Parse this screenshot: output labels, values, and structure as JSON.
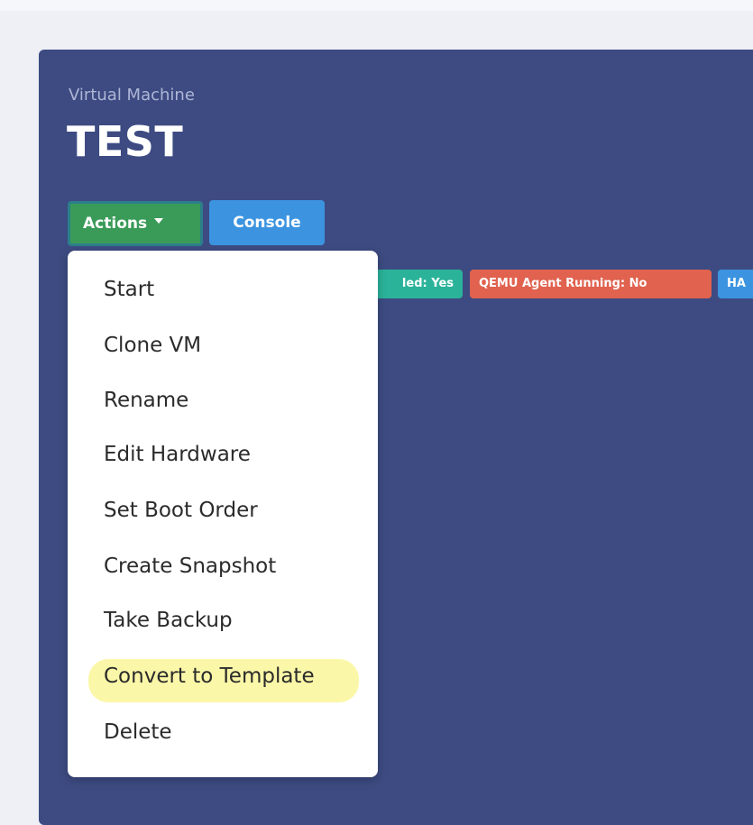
{
  "header": {
    "subtitle": "Virtual Machine",
    "title": "TEST"
  },
  "toolbar": {
    "actions_label": "Actions",
    "console_label": "Console"
  },
  "badges": [
    {
      "text": "led: Yes",
      "color": "#2bb39a"
    },
    {
      "text": "QEMU Agent Running: No",
      "color": "#e0624f"
    },
    {
      "text": "HA",
      "color": "#3c94e0"
    }
  ],
  "actions_menu": {
    "items": [
      {
        "label": "Start"
      },
      {
        "label": "Clone VM"
      },
      {
        "label": "Rename"
      },
      {
        "label": "Edit Hardware"
      },
      {
        "label": "Set Boot Order"
      },
      {
        "label": "Create Snapshot"
      },
      {
        "label": "Take Backup"
      },
      {
        "label": "Convert to Template",
        "highlighted": true
      },
      {
        "label": "Delete"
      }
    ]
  },
  "colors": {
    "panel": "#3d4b82",
    "actions_button": "#3a9b59",
    "console_button": "#3c94e0",
    "highlight": "#fbf7a8"
  }
}
